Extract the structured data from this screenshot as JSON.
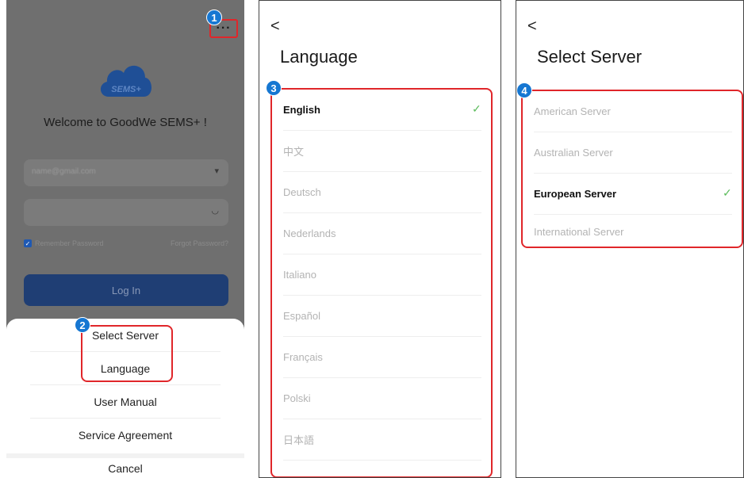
{
  "login_screen": {
    "more_icon": "more-horizontal-icon",
    "badge": "1",
    "logo_text": "SEMS+",
    "welcome": "Welcome to GoodWe SEMS+ !",
    "remember_label": "Remember Password",
    "forgot_label": "Forgot Password?",
    "login_label": "Log In",
    "menu_badge": "2",
    "menu": [
      "Select Server",
      "Language",
      "User Manual",
      "Service Agreement"
    ],
    "cancel_label": "Cancel"
  },
  "language_screen": {
    "back_icon": "<",
    "title": "Language",
    "badge": "3",
    "languages": [
      "English",
      "中文",
      "Deutsch",
      "Nederlands",
      "Italiano",
      "Español",
      "Français",
      "Polski",
      "日本語"
    ],
    "selected": "English"
  },
  "server_screen": {
    "back_icon": "<",
    "title": "Select Server",
    "badge": "4",
    "servers": [
      "American Server",
      "Australian Server",
      "European Server",
      "International Server"
    ],
    "selected": "European Server"
  },
  "colors": {
    "highlight": "#e0262a",
    "badge": "#1677d2",
    "check": "#5cbc5c",
    "login_button": "#1f3e74"
  }
}
